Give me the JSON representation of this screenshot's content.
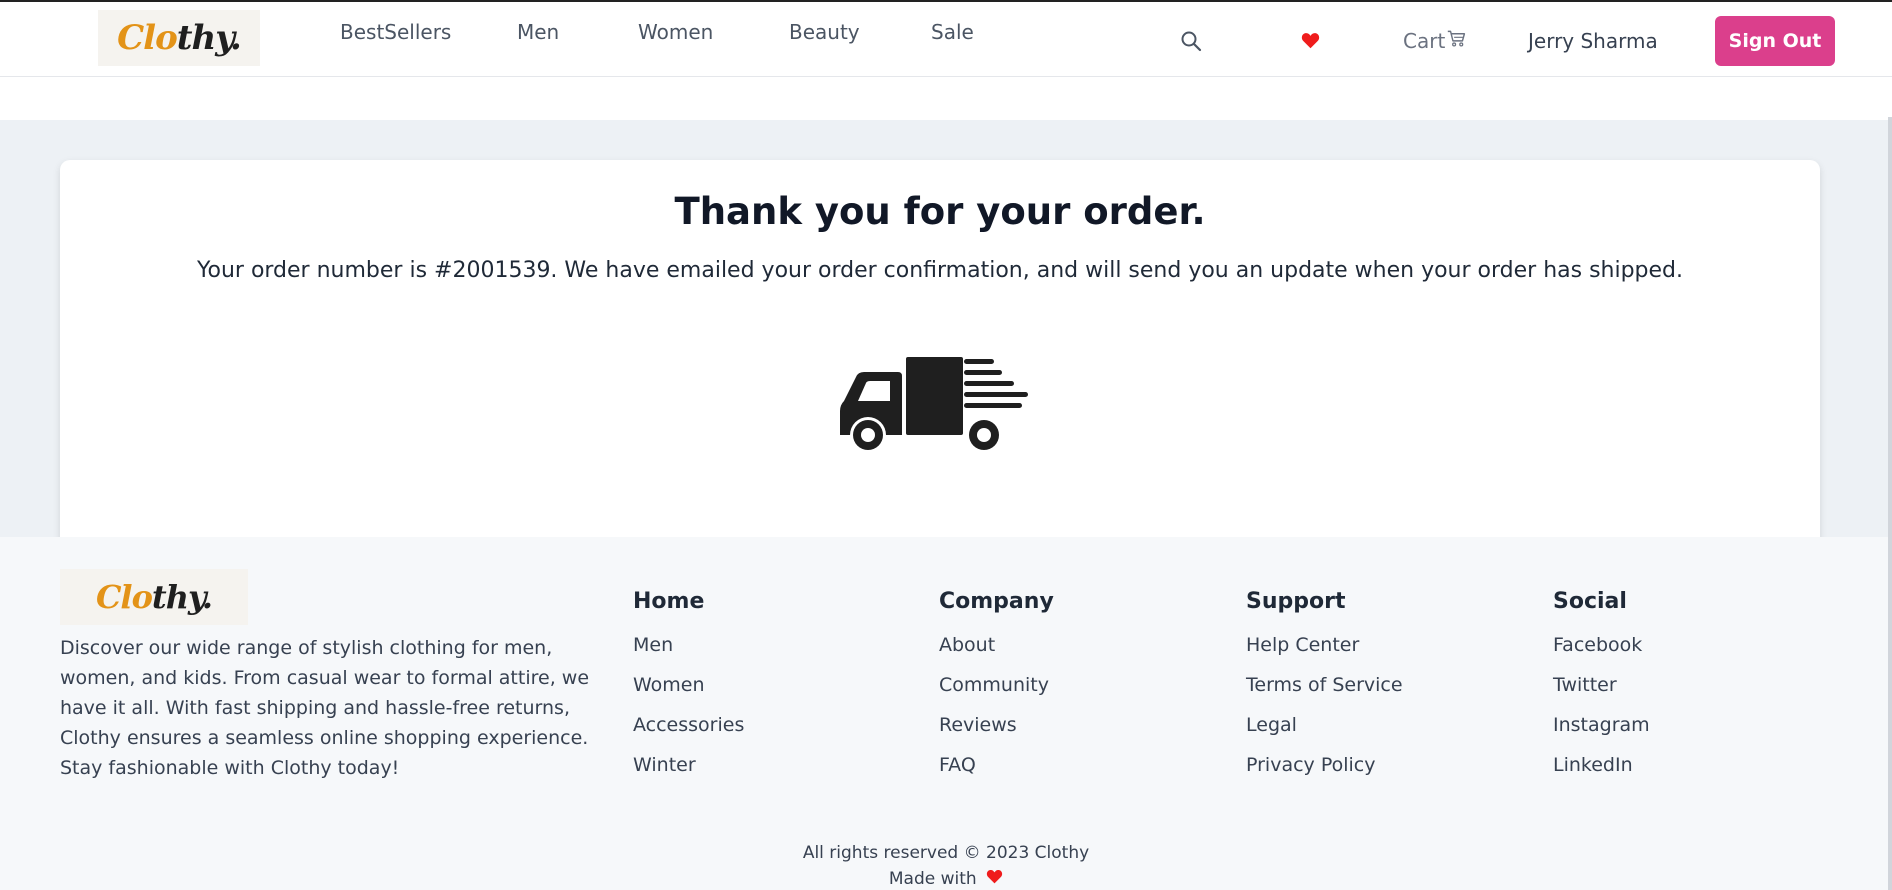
{
  "header": {
    "logo": {
      "part1": "Clo",
      "part2": "thy."
    },
    "nav": [
      "BestSellers",
      "Men",
      "Women",
      "Beauty",
      "Sale"
    ],
    "icons": {
      "search": "search-icon",
      "wishlist": "heart-icon",
      "cart": "cart-icon"
    },
    "cart_label": "Cart",
    "user_name": "Jerry Sharma",
    "signout_label": "Sign Out"
  },
  "confirmation": {
    "title": "Thank you for your order.",
    "message": "Your order number is #2001539. We have emailed your order confirmation, and will send you an update when your order has shipped.",
    "illustration": "delivery-truck-icon"
  },
  "footer": {
    "logo": {
      "part1": "Clo",
      "part2": "thy."
    },
    "description": "Discover our wide range of stylish clothing for men, women, and kids. From casual wear to formal attire, we have it all. With fast shipping and hassle-free returns, Clothy ensures a seamless online shopping experience. Stay fashionable with Clothy today!",
    "columns": [
      {
        "title": "Home",
        "links": [
          "Men",
          "Women",
          "Accessories",
          "Winter"
        ]
      },
      {
        "title": "Company",
        "links": [
          "About",
          "Community",
          "Reviews",
          "FAQ"
        ]
      },
      {
        "title": "Support",
        "links": [
          "Help Center",
          "Terms of Service",
          "Legal",
          "Privacy Policy"
        ]
      },
      {
        "title": "Social",
        "links": [
          "Facebook",
          "Twitter",
          "Instagram",
          "LinkedIn"
        ]
      }
    ],
    "rights": "All rights reserved © 2023 Clothy",
    "made_with": "Made with"
  },
  "colors": {
    "brand_orange": "#e39318",
    "brand_dark": "#1f1f1f",
    "signout_bg": "#db3f8c",
    "heart_red": "#ef1c1c",
    "band_bg": "#edf1f5"
  }
}
